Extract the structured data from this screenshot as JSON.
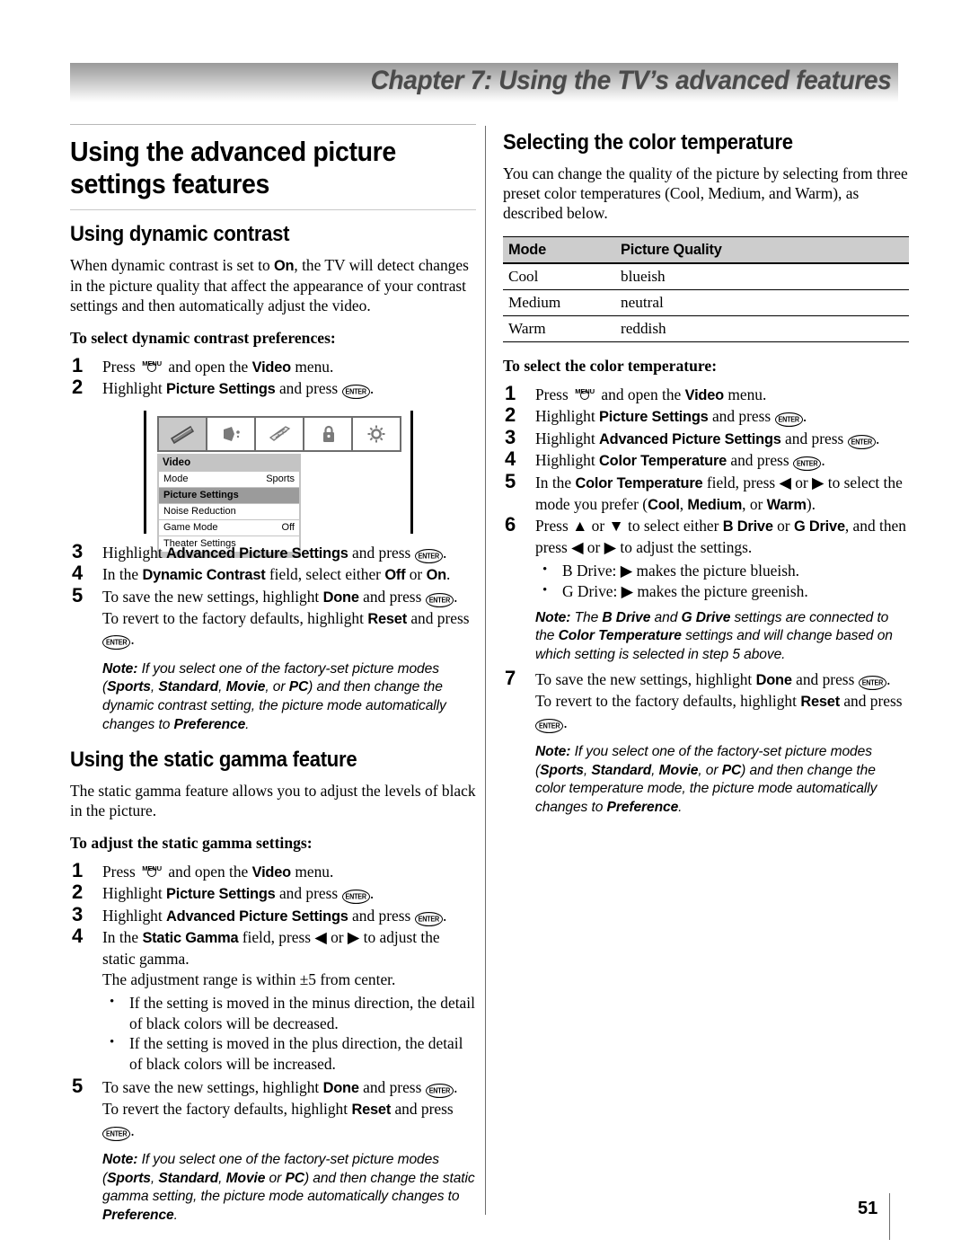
{
  "chapter": {
    "title": "Chapter 7: Using the TV’s advanced features"
  },
  "page": {
    "number": "51"
  },
  "left": {
    "section_title": "Using the advanced picture settings features",
    "dynamic_contrast": {
      "heading": "Using dynamic contrast",
      "intro_1": "When dynamic contrast is set to ",
      "intro_on": "On",
      "intro_2": ", the TV will detect changes in the picture quality that affect the appearance of your contrast settings and then automatically adjust the video.",
      "lead": "To select dynamic contrast preferences:",
      "steps": [
        {
          "n": "1",
          "pre": "Press ",
          "key": "MENU",
          "mid": " and open the ",
          "bold": "Video",
          "post": " menu."
        },
        {
          "n": "2",
          "pre": "Highlight ",
          "bold": "Picture Settings",
          "mid": " and press ",
          "key": "ENTER",
          "post": "."
        },
        {
          "n": "3",
          "pre": "Highlight ",
          "bold": "Advanced Picture Settings",
          "mid": " and press ",
          "key": "ENTER",
          "post": "."
        },
        {
          "n": "4",
          "pre": "In the ",
          "bold": "Dynamic Contrast",
          "mid": " field, select either ",
          "bold2": "Off",
          "mid2": " or ",
          "bold3": "On",
          "post": "."
        },
        {
          "n": "5",
          "pre": "To save the new settings, highlight ",
          "bold": "Done",
          "mid": " and press ",
          "key": "ENTER",
          "post": ".",
          "line2_pre": "To revert to the factory defaults, highlight ",
          "line2_bold": "Reset",
          "line2_mid": " and press ",
          "line2_key": "ENTER",
          "line2_post": "."
        }
      ],
      "note": {
        "label": "Note:",
        "t1": " If you select one of the factory-set picture modes (",
        "m1": "Sports",
        "s1": ", ",
        "m2": "Standard",
        "s2": ", ",
        "m3": "Movie",
        "s3": ", or ",
        "m4": "PC",
        "t2": ") and then change the dynamic contrast setting, the picture mode automatically changes to ",
        "pref": "Preference",
        "t3": "."
      }
    },
    "figure": {
      "icons": [
        "video-icon",
        "audio-speaker-icon",
        "settings-sliders-icon",
        "lock-icon",
        "brightness-sun-icon"
      ],
      "menu_title": "Video",
      "rows": [
        {
          "label": "Mode",
          "value": "Sports",
          "highlight": false
        },
        {
          "label": "Picture Settings",
          "value": "",
          "highlight": true
        },
        {
          "label": "Noise Reduction",
          "value": "",
          "highlight": false
        },
        {
          "label": "Game Mode",
          "value": "Off",
          "highlight": false
        },
        {
          "label": "Theater Settings",
          "value": "",
          "highlight": false
        }
      ]
    },
    "static_gamma": {
      "heading": "Using the static gamma feature",
      "intro": "The static gamma feature allows you to adjust the levels of black in the picture.",
      "lead": "To adjust the static gamma settings:",
      "steps": [
        {
          "n": "1",
          "pre": "Press ",
          "key": "MENU",
          "mid": " and open the ",
          "bold": "Video",
          "post": " menu."
        },
        {
          "n": "2",
          "pre": "Highlight ",
          "bold": "Picture Settings",
          "mid": " and press ",
          "key": "ENTER",
          "post": "."
        },
        {
          "n": "3",
          "pre": "Highlight ",
          "bold": "Advanced Picture Settings",
          "mid": " and press ",
          "key": "ENTER",
          "post": "."
        },
        {
          "n": "4",
          "pre": "In the ",
          "bold": "Static Gamma",
          "mid": " field, press ◀ or ▶ to adjust the static gamma.",
          "line2": "The adjustment range is within ±5 from center."
        },
        {
          "n": "5",
          "pre": "To save the new settings, highlight ",
          "bold": "Done",
          "mid": " and press ",
          "key": "ENTER",
          "post": ".",
          "line2_pre": "To revert the factory defaults, highlight ",
          "line2_bold": "Reset",
          "line2_mid": " and press ",
          "line2_key": "ENTER",
          "line2_post": "."
        }
      ],
      "bullets": [
        "If the setting is moved in the minus direction, the detail of black colors will be decreased.",
        "If the setting is moved in the plus direction, the detail of black colors will be increased."
      ],
      "note": {
        "label": "Note:",
        "t1": " If you select one of the factory-set picture modes (",
        "m1": "Sports",
        "s1": ", ",
        "m2": "Standard",
        "s2": ", ",
        "m3": "Movie",
        "s3": " or ",
        "m4": "PC",
        "t2": ") and then change the static gamma setting, the picture mode automatically changes to ",
        "pref": "Preference",
        "t3": "."
      }
    }
  },
  "right": {
    "heading": "Selecting the color temperature",
    "intro": "You can change the quality of the picture by selecting from three preset color temperatures (Cool, Medium, and Warm), as described below.",
    "table": {
      "headers": [
        "Mode",
        "Picture Quality"
      ],
      "rows": [
        [
          "Cool",
          "blueish"
        ],
        [
          "Medium",
          "neutral"
        ],
        [
          "Warm",
          "reddish"
        ]
      ]
    },
    "lead": "To select the color temperature:",
    "steps": [
      {
        "n": "1",
        "pre": "Press ",
        "key": "MENU",
        "mid": " and open the ",
        "bold": "Video",
        "post": " menu."
      },
      {
        "n": "2",
        "pre": "Highlight ",
        "bold": "Picture Settings",
        "mid": " and press ",
        "key": "ENTER",
        "post": "."
      },
      {
        "n": "3",
        "pre": "Highlight ",
        "bold": "Advanced Picture Settings",
        "mid": " and press ",
        "key": "ENTER",
        "post": "."
      },
      {
        "n": "4",
        "pre": "Highlight ",
        "bold": "Color Temperature",
        "mid": " and press ",
        "key": "ENTER",
        "post": "."
      },
      {
        "n": "5",
        "pre": "In the ",
        "bold": "Color Temperature",
        "mid": " field, press ◀ or ▶ to select the mode you prefer (",
        "b1": "Cool",
        "s1": ", ",
        "b2": "Medium",
        "s2": ", or ",
        "b3": "Warm",
        "post": ")."
      },
      {
        "n": "6",
        "pre": "Press ▲ or ▼ to select either ",
        "b1": "B Drive",
        "s1": " or ",
        "b2": "G Drive",
        "post": ", and then press ◀ or ▶ to adjust the settings."
      },
      {
        "n": "7",
        "pre": "To save the new settings, highlight ",
        "bold": "Done",
        "mid": " and press ",
        "key": "ENTER",
        "post": ".",
        "line2_pre": "To revert to the factory defaults, highlight ",
        "line2_bold": "Reset",
        "line2_mid": " and press ",
        "line2_key": "ENTER",
        "line2_post": "."
      }
    ],
    "bullets": [
      "B Drive: ▶ makes the picture blueish.",
      "G Drive: ▶ makes the picture greenish."
    ],
    "note_drive": {
      "label": "Note:",
      "t1": " The ",
      "b1": "B Drive",
      "t2": " and ",
      "b2": "G Drive",
      "t3": " settings are connected to the ",
      "b3": "Color Temperature",
      "t4": " settings and will change based on which setting is selected in step 5 above."
    },
    "note_pref": {
      "label": "Note:",
      "t1": " If you select one of the factory-set picture modes (",
      "m1": "Sports",
      "s1": ", ",
      "m2": "Standard",
      "s2": ", ",
      "m3": "Movie",
      "s3": ", or ",
      "m4": "PC",
      "t2": ") and then change the color temperature mode, the picture mode automatically changes to ",
      "pref": "Preference",
      "t3": "."
    }
  },
  "keys": {
    "menu": "MENU",
    "enter": "ENTER"
  },
  "colors": {
    "bar_gray": "#9a9a9a",
    "table_header": "#cdcdcd",
    "menu_bg": "#c4c4c4",
    "menu_highlight": "#9b9b9b"
  }
}
